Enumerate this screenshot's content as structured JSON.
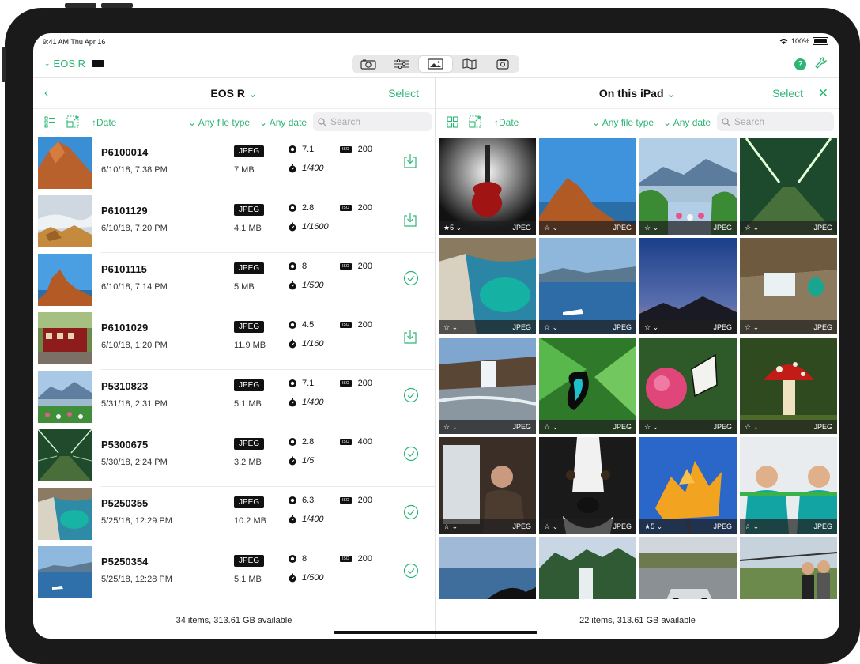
{
  "status": {
    "time": "9:41 AM  Thu Apr 16",
    "battery": "100%"
  },
  "camera": {
    "name": "EOS R"
  },
  "colors": {
    "accent": "#2bb673"
  },
  "toolbar": {
    "tabs": [
      "camera-icon",
      "sliders-icon",
      "gallery-icon",
      "map-icon",
      "library-icon"
    ],
    "active_index": 2
  },
  "left": {
    "title": "EOS R",
    "select": "Select",
    "sort": "Date",
    "filter_type": "Any file type",
    "filter_date": "Any date",
    "search_placeholder": "Search",
    "footer": "34 items, 313.61 GB available",
    "rows": [
      {
        "name": "P6100014",
        "date": "6/10/18, 7:38 PM",
        "format": "JPEG",
        "size": "7 MB",
        "aperture": "7.1",
        "shutter": "1/400",
        "iso": "200",
        "state": "download"
      },
      {
        "name": "P6101129",
        "date": "6/10/18, 7:20 PM",
        "format": "JPEG",
        "size": "4.1 MB",
        "aperture": "2.8",
        "shutter": "1/1600",
        "iso": "200",
        "state": "download"
      },
      {
        "name": "P6101115",
        "date": "6/10/18, 7:14 PM",
        "format": "JPEG",
        "size": "5 MB",
        "aperture": "8",
        "shutter": "1/500",
        "iso": "200",
        "state": "done"
      },
      {
        "name": "P6101029",
        "date": "6/10/18, 1:20 PM",
        "format": "JPEG",
        "size": "11.9 MB",
        "aperture": "4.5",
        "shutter": "1/160",
        "iso": "200",
        "state": "download"
      },
      {
        "name": "P5310823",
        "date": "5/31/18, 2:31 PM",
        "format": "JPEG",
        "size": "5.1 MB",
        "aperture": "7.1",
        "shutter": "1/400",
        "iso": "200",
        "state": "done"
      },
      {
        "name": "P5300675",
        "date": "5/30/18, 2:24 PM",
        "format": "JPEG",
        "size": "3.2 MB",
        "aperture": "2.8",
        "shutter": "1/5",
        "iso": "400",
        "state": "done"
      },
      {
        "name": "P5250355",
        "date": "5/25/18, 12:29 PM",
        "format": "JPEG",
        "size": "10.2 MB",
        "aperture": "6.3",
        "shutter": "1/400",
        "iso": "200",
        "state": "done"
      },
      {
        "name": "P5250354",
        "date": "5/25/18, 12:28 PM",
        "format": "JPEG",
        "size": "5.1 MB",
        "aperture": "8",
        "shutter": "1/500",
        "iso": "200",
        "state": "done"
      }
    ]
  },
  "right": {
    "title": "On this iPad",
    "select": "Select",
    "sort": "Date",
    "filter_type": "Any file type",
    "filter_date": "Any date",
    "search_placeholder": "Search",
    "footer": "22 items, 313.61 GB available",
    "tiles": [
      {
        "rating": "5",
        "format": "JPEG"
      },
      {
        "rating": "",
        "format": "JPEG"
      },
      {
        "rating": "",
        "format": "JPEG"
      },
      {
        "rating": "",
        "format": "JPEG"
      },
      {
        "rating": "",
        "format": "JPEG"
      },
      {
        "rating": "",
        "format": "JPEG"
      },
      {
        "rating": "",
        "format": "JPEG"
      },
      {
        "rating": "",
        "format": "JPEG"
      },
      {
        "rating": "",
        "format": "JPEG"
      },
      {
        "rating": "",
        "format": "JPEG"
      },
      {
        "rating": "",
        "format": "JPEG"
      },
      {
        "rating": "",
        "format": "JPEG"
      },
      {
        "rating": "",
        "format": "JPEG"
      },
      {
        "rating": "",
        "format": "JPEG"
      },
      {
        "rating": "5",
        "format": "JPEG"
      },
      {
        "rating": "",
        "format": "JPEG"
      }
    ]
  }
}
